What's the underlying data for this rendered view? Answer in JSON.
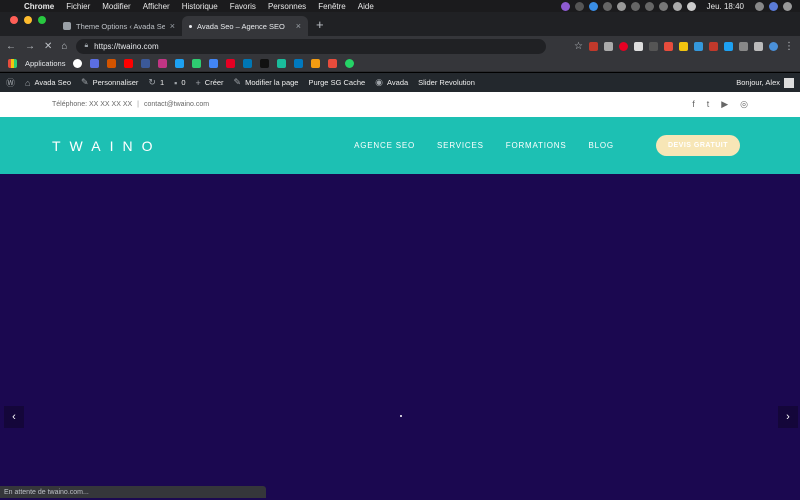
{
  "menubar": {
    "app": "Chrome",
    "items": [
      "Fichier",
      "Modifier",
      "Afficher",
      "Historique",
      "Favoris",
      "Personnes",
      "Fenêtre",
      "Aide"
    ],
    "clock": "Jeu. 18:40"
  },
  "tabs": [
    {
      "title": "Theme Options ‹ Avada Seo —",
      "close": "×"
    },
    {
      "title": "Avada Seo – Agence SEO",
      "close": "×"
    }
  ],
  "toolbar": {
    "url": "https://twaino.com",
    "back": "←",
    "forward": "→",
    "stop": "✕",
    "home": "⌂",
    "star": "☆"
  },
  "bookmarks": {
    "apps_label": "Applications"
  },
  "wpbar": {
    "site": "Avada Seo",
    "customize": "Personnaliser",
    "updates_count": "1",
    "comments_count": "0",
    "new": "Créer",
    "edit_page": "Modifier la page",
    "purge": "Purge SG Cache",
    "avada": "Avada",
    "slider": "Slider Revolution",
    "greeting": "Bonjour, Alex"
  },
  "site": {
    "phone": "Téléphone: XX XX XX XX",
    "separator": "|",
    "email": "contact@twaino.com",
    "logo": "TWAINO",
    "nav": [
      "AGENCE SEO",
      "SERVICES",
      "FORMATIONS",
      "BLOG"
    ],
    "cta": "DEVIS GRATUIT",
    "social": [
      "f",
      "t",
      "▶",
      "◎"
    ]
  },
  "slider": {
    "prev": "‹",
    "next": "›"
  },
  "status": "En attente de twaino.com...",
  "colors": {
    "header_teal": "#1dc0b3",
    "hero_bg": "#1b0850",
    "cta_bg": "#f7e6b6"
  }
}
